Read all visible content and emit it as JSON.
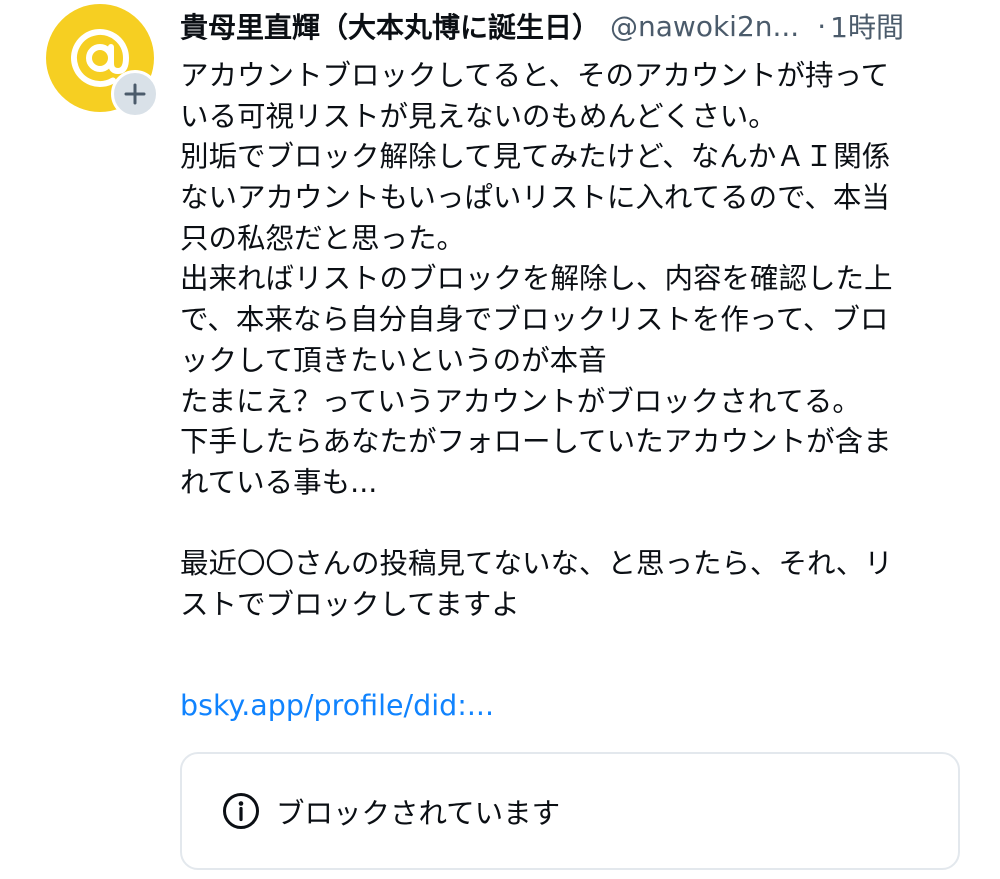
{
  "author": {
    "display_name": "貴母里直輝（大本丸博に誕生日）",
    "handle": "@nawoki2n...",
    "separator": "·",
    "time": "1時間",
    "avatar_icon": "at-sign-icon",
    "avatar_color": "#f6cf22",
    "follow_icon": "plus-icon"
  },
  "post": {
    "lines": [
      "アカウントブロックしてると、そのアカウントが持って",
      "いる可視リストが見えないのもめんどくさい。",
      "別垢でブロック解除して見てみたけど、なんかＡＩ関係",
      "ないアカウントもいっぱいリストに入れてるので、本当",
      "只の私怨だと思った。",
      "出来ればリストのブロックを解除し、内容を確認した上",
      "で、本来なら自分自身でブロックリストを作って、ブロ",
      "ックして頂きたいというのが本音",
      "たまにえ？っていうアカウントがブロックされてる。",
      "下手したらあなたがフォローしていたアカウントが含ま",
      "れている事も...",
      "",
      "最近〇〇さんの投稿見てないな、と思ったら、それ、リ",
      "ストでブロックしてますよ"
    ],
    "link_text": "bsky.app/profile/did:...",
    "link_color": "#1083fe"
  },
  "embed": {
    "icon": "info-icon",
    "label": "ブロックされています"
  }
}
